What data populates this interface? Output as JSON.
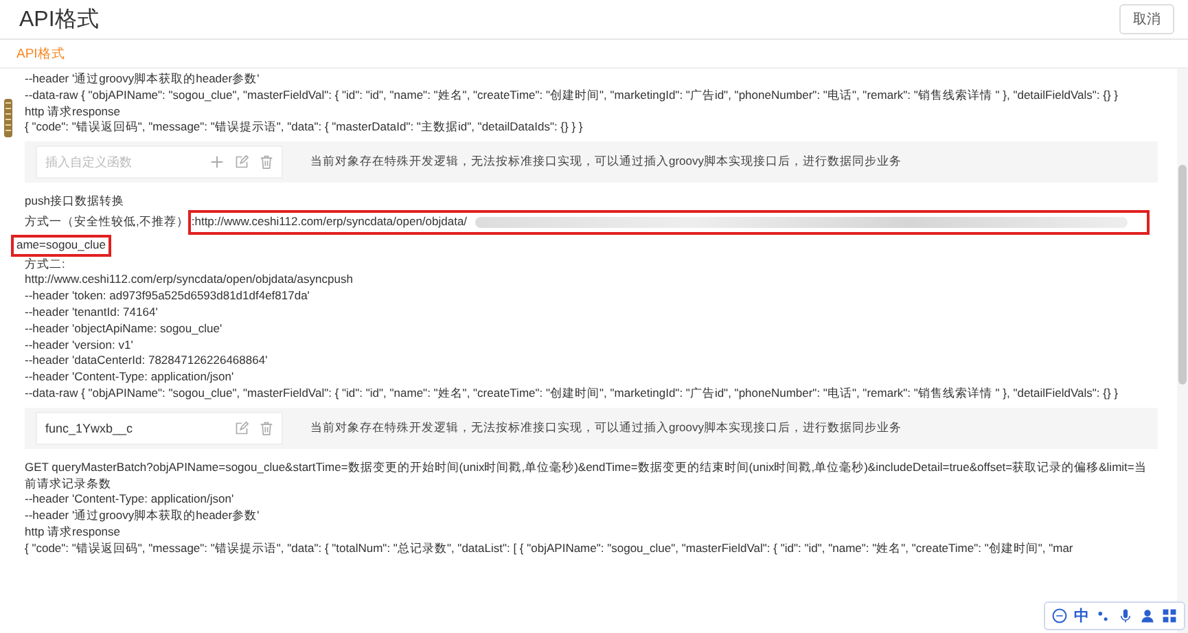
{
  "dialog": {
    "title": "API格式",
    "cancel_button": "取消"
  },
  "tabs": [
    {
      "label": "API格式",
      "selected": true
    }
  ],
  "sections": [
    {
      "kind": "lines",
      "lines": [
        "--header '通过groovy脚本获取的header参数'",
        "--data-raw { \"objAPIName\": \"sogou_clue\", \"masterFieldVal\": { \"id\": \"id\", \"name\": \"姓名\", \"createTime\": \"创建时间\", \"marketingId\": \"广告id\", \"phoneNumber\": \"电话\", \"remark\": \"销售线索详情 \" }, \"detailFieldVals\": {} }",
        "http 请求response",
        "{ \"code\": \"错误返回码\", \"message\": \"错误提示语\", \"data\": { \"masterDataId\": \"主数据id\", \"detailDataIds\": {} } }"
      ]
    },
    {
      "kind": "function",
      "placeholder": "插入自定义函数",
      "can_add": true,
      "description": "当前对象存在特殊开发逻辑，无法按标准接口实现，可以通过插入groovy脚本实现接口后，进行数据同步业务"
    },
    {
      "kind": "push",
      "heading": "push接口数据转换",
      "method1_label": "方式一（安全性较低,不推荐）",
      "method1_url": ":http://www.ceshi112.com/erp/syncdata/open/objdata/",
      "method1_tail": "ame=sogou_clue",
      "method2_label": "方式二:"
    },
    {
      "kind": "lines",
      "lines": [
        "http://www.ceshi112.com/erp/syncdata/open/objdata/asyncpush",
        "--header 'token: ad973f95a525d6593d81d1df4ef817da'",
        "--header 'tenantId: 74164'",
        "--header 'objectApiName: sogou_clue'",
        "--header 'version: v1'",
        "--header 'dataCenterId: 782847126226468864'",
        "--header 'Content-Type: application/json'",
        "--data-raw { \"objAPIName\": \"sogou_clue\", \"masterFieldVal\": { \"id\": \"id\", \"name\": \"姓名\", \"createTime\": \"创建时间\", \"marketingId\": \"广告id\", \"phoneNumber\": \"电话\", \"remark\": \"销售线索详情 \" }, \"detailFieldVals\": {} }"
      ]
    },
    {
      "kind": "function",
      "value": "func_1Ywxb__c",
      "can_add": false,
      "description": "当前对象存在特殊开发逻辑，无法按标准接口实现，可以通过插入groovy脚本实现接口后，进行数据同步业务"
    },
    {
      "kind": "lines",
      "lines": [
        "GET queryMasterBatch?objAPIName=sogou_clue&startTime=数据变更的开始时间(unix时间戳,单位毫秒)&endTime=数据变更的结束时间(unix时间戳,单位毫秒)&includeDetail=true&offset=获取记录的偏移&limit=当前请求记录条数",
        "--header 'Content-Type: application/json'",
        "--header '通过groovy脚本获取的header参数'",
        "http 请求response",
        "{ \"code\": \"错误返回码\", \"message\": \"错误提示语\", \"data\": { \"totalNum\": \"总记录数\", \"dataList\": [ { \"objAPIName\": \"sogou_clue\", \"masterFieldVal\": { \"id\": \"id\", \"name\": \"姓名\", \"createTime\": \"创建时间\", \"mar"
      ]
    }
  ],
  "ime_toolbar": {
    "mode": "中"
  }
}
